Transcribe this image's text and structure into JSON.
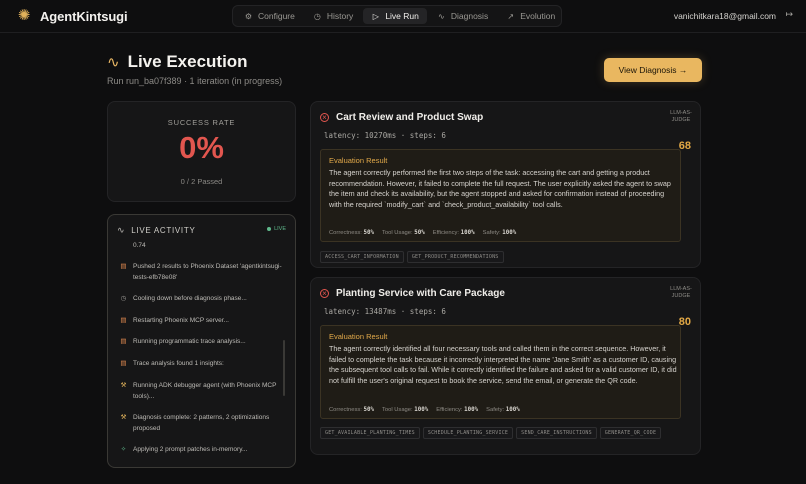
{
  "app": {
    "name": "AgentKintsugi",
    "logo_icon": "kintsugi-logo-icon"
  },
  "nav": {
    "tabs": [
      {
        "label": "Configure",
        "icon": "gear-icon",
        "active": false
      },
      {
        "label": "History",
        "icon": "clock-icon",
        "active": false
      },
      {
        "label": "Live Run",
        "icon": "play-icon",
        "active": true
      },
      {
        "label": "Diagnosis",
        "icon": "pulse-icon",
        "active": false
      },
      {
        "label": "Evolution",
        "icon": "trend-icon",
        "active": false
      }
    ],
    "user_email": "vanichitkara18@gmail.com"
  },
  "header": {
    "title": "Live Execution",
    "subtitle": "Run run_ba07f389 · 1 iteration (in progress)",
    "view_button": "View Diagnosis →"
  },
  "success": {
    "label": "SUCCESS RATE",
    "value": "0%",
    "sub": "0 / 2 Passed"
  },
  "activity": {
    "title": "LIVE ACTIVITY",
    "live_label": "LIVE",
    "items": [
      {
        "icon": "",
        "text": "0.74"
      },
      {
        "icon": "db-icon",
        "text": "Pushed 2 results to Phoenix Dataset 'agentkintsugi-tests-efb78e08'"
      },
      {
        "icon": "clock-icon",
        "text": "Cooling down before diagnosis phase..."
      },
      {
        "icon": "db-icon",
        "text": "Restarting Phoenix MCP server..."
      },
      {
        "icon": "db-icon",
        "text": "Running programmatic trace analysis..."
      },
      {
        "icon": "db-icon",
        "text": "Trace analysis found 1 insights:"
      },
      {
        "icon": "hammer-icon",
        "text": "Running ADK debugger agent (with Phoenix MCP tools)..."
      },
      {
        "icon": "hammer-icon",
        "text": "Diagnosis complete: 2 patterns, 2 optimizations proposed"
      },
      {
        "icon": "sparkle-icon",
        "text": "Applying 2 prompt patches in-memory..."
      }
    ]
  },
  "results": [
    {
      "title": "Cart Review and Product Swap",
      "latency": "latency: 10270ms · steps: 6",
      "judge": "LLM-AS-JUDGE",
      "score": "68",
      "eval_heading": "Evaluation Result",
      "eval_text": "The agent correctly performed the first two steps of the task: accessing the cart and getting a product recommendation. However, it failed to complete the full request. The user explicitly asked the agent to swap the item and check its availability, but the agent stopped and asked for confirmation instead of proceeding with the required `modify_cart` and `check_product_availability` tool calls.",
      "metrics": [
        {
          "label": "Correctness:",
          "value": "50%"
        },
        {
          "label": "Tool Usage:",
          "value": "50%"
        },
        {
          "label": "Efficiency:",
          "value": "100%"
        },
        {
          "label": "Safety:",
          "value": "100%"
        }
      ],
      "tags": [
        "ACCESS_CART_INFORMATION",
        "GET_PRODUCT_RECOMMENDATIONS"
      ]
    },
    {
      "title": "Planting Service with Care Package",
      "latency": "latency: 13487ms · steps: 6",
      "judge": "LLM-AS-JUDGE",
      "score": "80",
      "eval_heading": "Evaluation Result",
      "eval_text": "The agent correctly identified all four necessary tools and called them in the correct sequence. However, it failed to complete the task because it incorrectly interpreted the name 'Jane Smith' as a customer ID, causing the subsequent tool calls to fail. While it correctly identified the failure and asked for a valid customer ID, it did not fulfill the user's original request to book the service, send the email, or generate the QR code.",
      "metrics": [
        {
          "label": "Correctness:",
          "value": "50%"
        },
        {
          "label": "Tool Usage:",
          "value": "100%"
        },
        {
          "label": "Efficiency:",
          "value": "100%"
        },
        {
          "label": "Safety:",
          "value": "100%"
        }
      ],
      "tags": [
        "GET_AVAILABLE_PLANTING_TIMES",
        "SCHEDULE_PLANTING_SERVICE",
        "SEND_CARE_INSTRUCTIONS",
        "GENERATE_QR_CODE"
      ]
    }
  ],
  "colors": {
    "accent": "#e9b760",
    "fail": "#e2564f",
    "score": "#e2a845",
    "live": "#5fb98c"
  }
}
